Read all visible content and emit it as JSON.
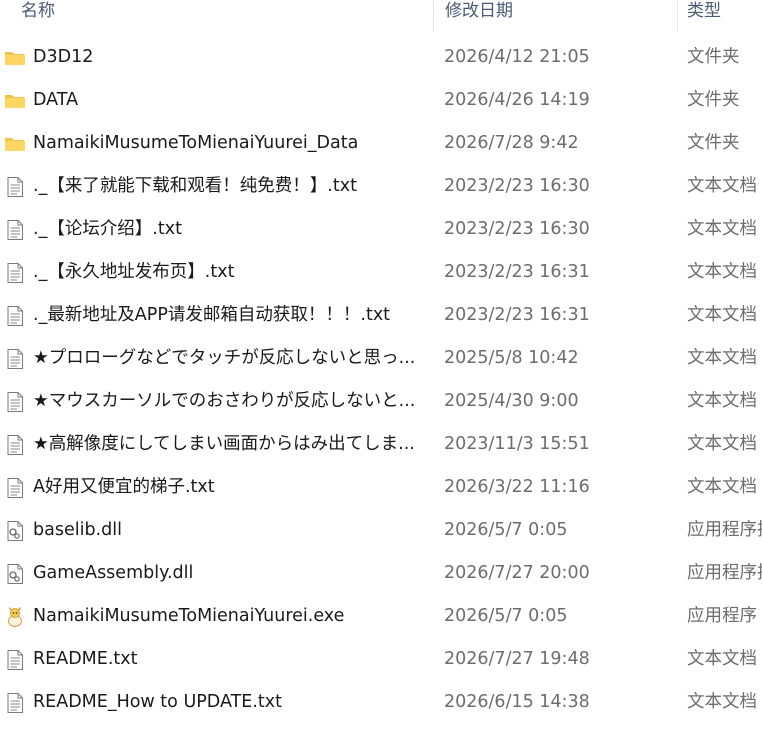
{
  "columns": {
    "name": "名称",
    "modified": "修改日期",
    "type": "类型"
  },
  "files": [
    {
      "icon": "folder-icon",
      "name": "D3D12",
      "modified": "2026/4/12 21:05",
      "type": "文件夹"
    },
    {
      "icon": "folder-icon",
      "name": "DATA",
      "modified": "2026/4/26 14:19",
      "type": "文件夹"
    },
    {
      "icon": "folder-icon",
      "name": "NamaikiMusumeToMienaiYuurei_Data",
      "modified": "2026/7/28 9:42",
      "type": "文件夹"
    },
    {
      "icon": "text-file-icon",
      "name": "._【来了就能下载和观看！纯免费！】.txt",
      "modified": "2023/2/23 16:30",
      "type": "文本文档"
    },
    {
      "icon": "text-file-icon",
      "name": "._【论坛介绍】.txt",
      "modified": "2023/2/23 16:30",
      "type": "文本文档"
    },
    {
      "icon": "text-file-icon",
      "name": "._【永久地址发布页】.txt",
      "modified": "2023/2/23 16:31",
      "type": "文本文档"
    },
    {
      "icon": "text-file-icon",
      "name": "._最新地址及APP请发邮箱自动获取！！！.txt",
      "modified": "2023/2/23 16:31",
      "type": "文本文档"
    },
    {
      "icon": "text-file-icon",
      "name": "★プロローグなどでタッチが反応しないと思っ...",
      "modified": "2025/5/8 10:42",
      "type": "文本文档"
    },
    {
      "icon": "text-file-icon",
      "name": "★マウスカーソルでのおさわりが反応しないと...",
      "modified": "2025/4/30 9:00",
      "type": "文本文档"
    },
    {
      "icon": "text-file-icon",
      "name": "★高解像度にしてしまい画面からはみ出てしま...",
      "modified": "2023/11/3 15:51",
      "type": "文本文档"
    },
    {
      "icon": "text-file-icon",
      "name": "A好用又便宜的梯子.txt",
      "modified": "2026/3/22 11:16",
      "type": "文本文档"
    },
    {
      "icon": "dll-file-icon",
      "name": "baselib.dll",
      "modified": "2026/5/7 0:05",
      "type": "应用程序扩"
    },
    {
      "icon": "dll-file-icon",
      "name": "GameAssembly.dll",
      "modified": "2026/7/27 20:00",
      "type": "应用程序扩"
    },
    {
      "icon": "app-exe-icon",
      "name": "NamaikiMusumeToMienaiYuurei.exe",
      "modified": "2026/5/7 0:05",
      "type": "应用程序"
    },
    {
      "icon": "text-file-icon",
      "name": "README.txt",
      "modified": "2026/7/27 19:48",
      "type": "文本文档"
    },
    {
      "icon": "text-file-icon",
      "name": "README_How to UPDATE.txt",
      "modified": "2026/6/15 14:38",
      "type": "文本文档"
    }
  ]
}
